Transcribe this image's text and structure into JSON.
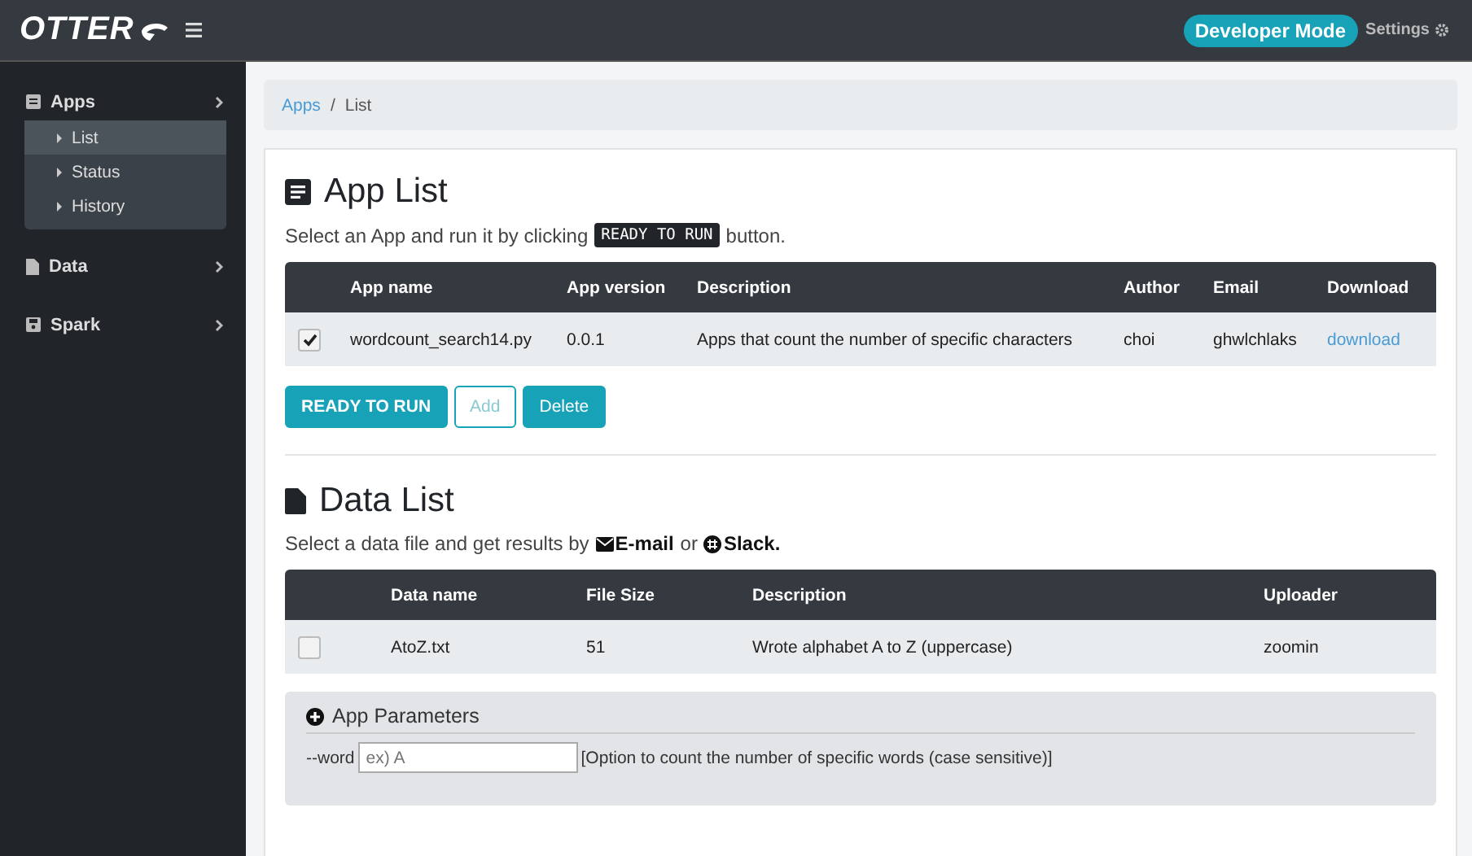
{
  "brand": {
    "logo": "OTTER"
  },
  "header": {
    "badge": "Developer Mode",
    "settings": "Settings"
  },
  "sidebar": {
    "items": [
      {
        "label": "Apps",
        "children": [
          {
            "label": "List",
            "selected": true
          },
          {
            "label": "Status",
            "selected": false
          },
          {
            "label": "History",
            "selected": false
          }
        ]
      },
      {
        "label": "Data"
      },
      {
        "label": "Spark"
      }
    ]
  },
  "breadcrumb": {
    "items": [
      "Apps",
      "List"
    ],
    "separator": "/"
  },
  "app_list": {
    "title": "App List",
    "intro_before": "Select an App and run it by clicking",
    "intro_code": "READY TO RUN",
    "intro_after": "button.",
    "columns": [
      "App name",
      "App version",
      "Description",
      "Author",
      "Email",
      "Download"
    ],
    "rows": [
      {
        "checked": true,
        "cells": [
          "wordcount_search14.py",
          "0.0.1",
          "Apps that count the number of specific characters",
          "choi",
          "ghwlchlaks"
        ],
        "link": "download"
      }
    ],
    "buttons": [
      {
        "label": "READY TO RUN",
        "kind": "primary"
      },
      {
        "label": "Add",
        "kind": "outline"
      },
      {
        "label": "Delete",
        "kind": "solid"
      }
    ]
  },
  "data_list": {
    "title": "Data List",
    "intro_before": "Select a data file and get results by",
    "email": "E-mail",
    "or": "or",
    "slack": "Slack.",
    "columns": [
      "Data name",
      "File Size",
      "Description",
      "Uploader"
    ],
    "rows": [
      {
        "checked": false,
        "cells": [
          "AtoZ.txt",
          "51",
          "Wrote alphabet A to Z (uppercase)",
          "zoomin"
        ]
      }
    ]
  },
  "params": {
    "title": "App Parameters",
    "fields": [
      {
        "label": "--word",
        "placeholder": "ex) A",
        "help": "[Option to count the number of specific words (case sensitive)]"
      }
    ]
  }
}
